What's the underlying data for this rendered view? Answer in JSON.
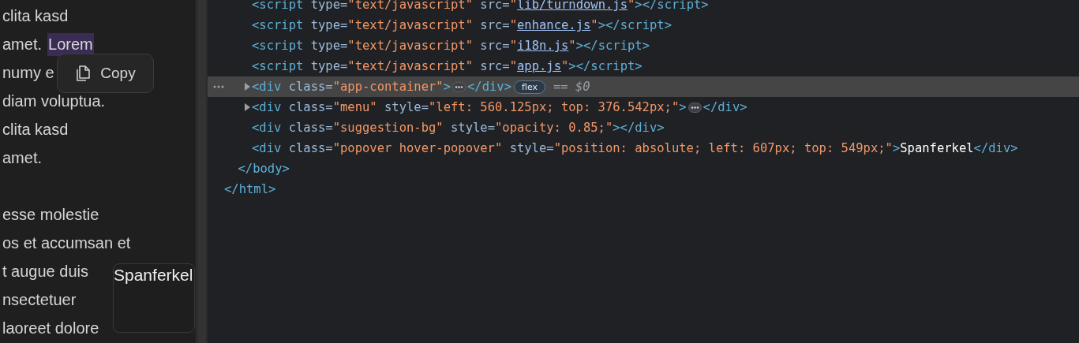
{
  "document": {
    "paragraphs": [
      [
        {
          "parts": [
            {
              "text": "clita kasd",
              "highlighted": false
            }
          ]
        },
        {
          "parts": [
            {
              "text": "amet.",
              "highlighted": false
            },
            {
              "text": "Lorem",
              "highlighted": true
            }
          ]
        },
        {
          "parts": [
            {
              "text": "numy e",
              "highlighted": false
            }
          ]
        },
        {
          "parts": [
            {
              "text": "diam voluptua.",
              "highlighted": false
            }
          ]
        },
        {
          "parts": [
            {
              "text": "clita kasd",
              "highlighted": false
            }
          ]
        },
        {
          "parts": [
            {
              "text": "amet.",
              "highlighted": false
            }
          ]
        }
      ],
      [
        {
          "parts": [
            {
              "text": "esse molestie",
              "highlighted": false
            }
          ]
        },
        {
          "parts": [
            {
              "text": "os et accumsan et",
              "highlighted": false
            }
          ]
        },
        {
          "parts": [
            {
              "text": "t augue duis",
              "highlighted": false
            }
          ]
        },
        {
          "parts": [
            {
              "text": "nsectetuer",
              "highlighted": false
            }
          ]
        },
        {
          "parts": [
            {
              "text": "laoreet dolore",
              "highlighted": false
            }
          ]
        }
      ]
    ]
  },
  "context_menu": {
    "items": [
      {
        "label": "Copy"
      }
    ]
  },
  "hover_popover": {
    "text": "Spanferkel"
  },
  "elements_tree": [
    {
      "closing_tokens": [
        {
          "kind": "tag",
          "text": "</html>"
        }
      ],
      "children": [
        {
          "closing_tokens": [
            {
              "kind": "tag",
              "text": "</body>"
            }
          ],
          "children": [
            {
              "selected": false,
              "tokens": [
                {
                  "kind": "tag",
                  "text": "<script"
                },
                {
                  "kind": "attr",
                  "text": " type="
                },
                {
                  "kind": "value",
                  "text": "\"text/javascript\""
                },
                {
                  "kind": "attr",
                  "text": " src="
                },
                {
                  "kind": "value",
                  "text": "\""
                },
                {
                  "kind": "link",
                  "text": "lib/turndown.js"
                },
                {
                  "kind": "value",
                  "text": "\""
                },
                {
                  "kind": "tag",
                  "text": "></script>"
                }
              ]
            },
            {
              "selected": false,
              "tokens": [
                {
                  "kind": "tag",
                  "text": "<script"
                },
                {
                  "kind": "attr",
                  "text": " type="
                },
                {
                  "kind": "value",
                  "text": "\"text/javascript\""
                },
                {
                  "kind": "attr",
                  "text": " src="
                },
                {
                  "kind": "value",
                  "text": "\""
                },
                {
                  "kind": "link",
                  "text": "enhance.js"
                },
                {
                  "kind": "value",
                  "text": "\""
                },
                {
                  "kind": "tag",
                  "text": "></script>"
                }
              ]
            },
            {
              "selected": false,
              "tokens": [
                {
                  "kind": "tag",
                  "text": "<script"
                },
                {
                  "kind": "attr",
                  "text": " type="
                },
                {
                  "kind": "value",
                  "text": "\"text/javascript\""
                },
                {
                  "kind": "attr",
                  "text": " src="
                },
                {
                  "kind": "value",
                  "text": "\""
                },
                {
                  "kind": "link",
                  "text": "i18n.js"
                },
                {
                  "kind": "value",
                  "text": "\""
                },
                {
                  "kind": "tag",
                  "text": "></script>"
                }
              ]
            },
            {
              "selected": false,
              "tokens": [
                {
                  "kind": "tag",
                  "text": "<script"
                },
                {
                  "kind": "attr",
                  "text": " type="
                },
                {
                  "kind": "value",
                  "text": "\"text/javascript\""
                },
                {
                  "kind": "attr",
                  "text": " src="
                },
                {
                  "kind": "value",
                  "text": "\""
                },
                {
                  "kind": "link",
                  "text": "app.js"
                },
                {
                  "kind": "value",
                  "text": "\""
                },
                {
                  "kind": "tag",
                  "text": "></script>"
                }
              ]
            },
            {
              "selected": true,
              "expanded": false,
              "tokens": [
                {
                  "kind": "tag",
                  "text": "<div"
                },
                {
                  "kind": "attr",
                  "text": " class="
                },
                {
                  "kind": "value",
                  "text": "\"app-container\""
                },
                {
                  "kind": "tag",
                  "text": ">"
                },
                {
                  "kind": "ellipsis"
                },
                {
                  "kind": "tag",
                  "text": "</div>"
                },
                {
                  "kind": "badge",
                  "text": "flex"
                },
                {
                  "kind": "ref",
                  "text": "== $0"
                }
              ]
            },
            {
              "selected": false,
              "expanded": false,
              "tokens": [
                {
                  "kind": "tag",
                  "text": "<div"
                },
                {
                  "kind": "attr",
                  "text": " class="
                },
                {
                  "kind": "value",
                  "text": "\"menu\""
                },
                {
                  "kind": "attr",
                  "text": " style="
                },
                {
                  "kind": "value",
                  "text": "\"left: 560.125px; top: 376.542px;\""
                },
                {
                  "kind": "tag",
                  "text": ">"
                },
                {
                  "kind": "ellipsis"
                },
                {
                  "kind": "tag",
                  "text": "</div>"
                }
              ]
            },
            {
              "selected": false,
              "tokens": [
                {
                  "kind": "tag",
                  "text": "<div"
                },
                {
                  "kind": "attr",
                  "text": " class="
                },
                {
                  "kind": "value",
                  "text": "\"suggestion-bg\""
                },
                {
                  "kind": "attr",
                  "text": " style="
                },
                {
                  "kind": "value",
                  "text": "\"opacity: 0.85;\""
                },
                {
                  "kind": "tag",
                  "text": "></div>"
                }
              ]
            },
            {
              "selected": false,
              "tokens": [
                {
                  "kind": "tag",
                  "text": "<div"
                },
                {
                  "kind": "attr",
                  "text": " class="
                },
                {
                  "kind": "value",
                  "text": "\"popover hover-popover\""
                },
                {
                  "kind": "attr",
                  "text": " style="
                },
                {
                  "kind": "value",
                  "text": "\"position: absolute; left: 607px; top: 549px;\""
                },
                {
                  "kind": "tag",
                  "text": ">"
                },
                {
                  "kind": "text",
                  "text": "Spanferkel"
                },
                {
                  "kind": "tag",
                  "text": "</div>"
                }
              ]
            }
          ]
        }
      ]
    }
  ]
}
